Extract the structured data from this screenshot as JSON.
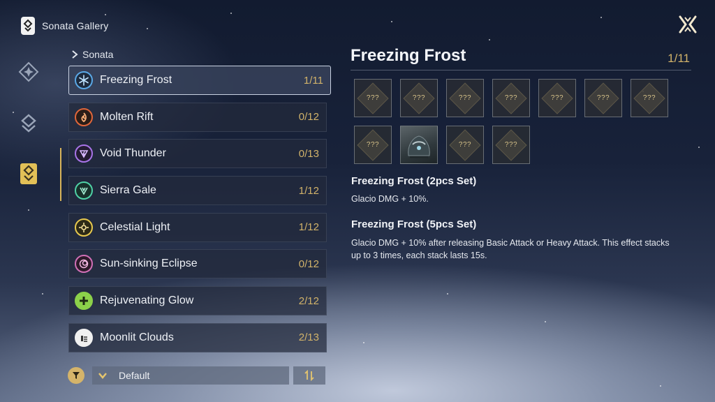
{
  "header": {
    "title": "Sonata Gallery",
    "icon": "sonata-book-icon"
  },
  "list": {
    "header": "Sonata",
    "items": [
      {
        "name": "Freezing Frost",
        "count": "1/11",
        "icon": "snowflake-icon",
        "color": "#5aa8e6",
        "selected": true
      },
      {
        "name": "Molten Rift",
        "count": "0/12",
        "icon": "flame-icon",
        "color": "#e0663a",
        "selected": false
      },
      {
        "name": "Void Thunder",
        "count": "0/13",
        "icon": "thunder-icon",
        "color": "#a974e8",
        "selected": false
      },
      {
        "name": "Sierra Gale",
        "count": "1/12",
        "icon": "wind-icon",
        "color": "#4fd1a6",
        "selected": false
      },
      {
        "name": "Celestial Light",
        "count": "1/12",
        "icon": "sun-icon",
        "color": "#e8c94e",
        "selected": false
      },
      {
        "name": "Sun-sinking Eclipse",
        "count": "0/12",
        "icon": "eclipse-icon",
        "color": "#d16fb6",
        "selected": false
      },
      {
        "name": "Rejuvenating Glow",
        "count": "2/12",
        "icon": "heal-plus-icon",
        "color": "#8cd14a",
        "selected": false
      },
      {
        "name": "Moonlit Clouds",
        "count": "2/13",
        "icon": "cloud-icon",
        "color": "#f0f0f0",
        "selected": false
      }
    ]
  },
  "filter": {
    "sort_label": "Default"
  },
  "detail": {
    "title": "Freezing Frost",
    "count": "1/11",
    "slots": [
      {
        "label": "???",
        "owned": false
      },
      {
        "label": "???",
        "owned": false
      },
      {
        "label": "???",
        "owned": false
      },
      {
        "label": "???",
        "owned": false
      },
      {
        "label": "???",
        "owned": false
      },
      {
        "label": "???",
        "owned": false
      },
      {
        "label": "???",
        "owned": false
      },
      {
        "label": "???",
        "owned": false
      },
      {
        "label": "",
        "owned": true
      },
      {
        "label": "???",
        "owned": false
      },
      {
        "label": "???",
        "owned": false
      }
    ],
    "set2_title": "Freezing Frost (2pcs Set)",
    "set2_desc": "Glacio DMG + 10%.",
    "set5_title": "Freezing Frost (5pcs Set)",
    "set5_desc": "Glacio DMG + 10% after releasing Basic Attack or Heavy Attack. This effect stacks up to 3 times, each stack lasts 15s."
  },
  "colors": {
    "accent_gold": "#d2b36a",
    "selected_border": "#c9d2e2"
  }
}
